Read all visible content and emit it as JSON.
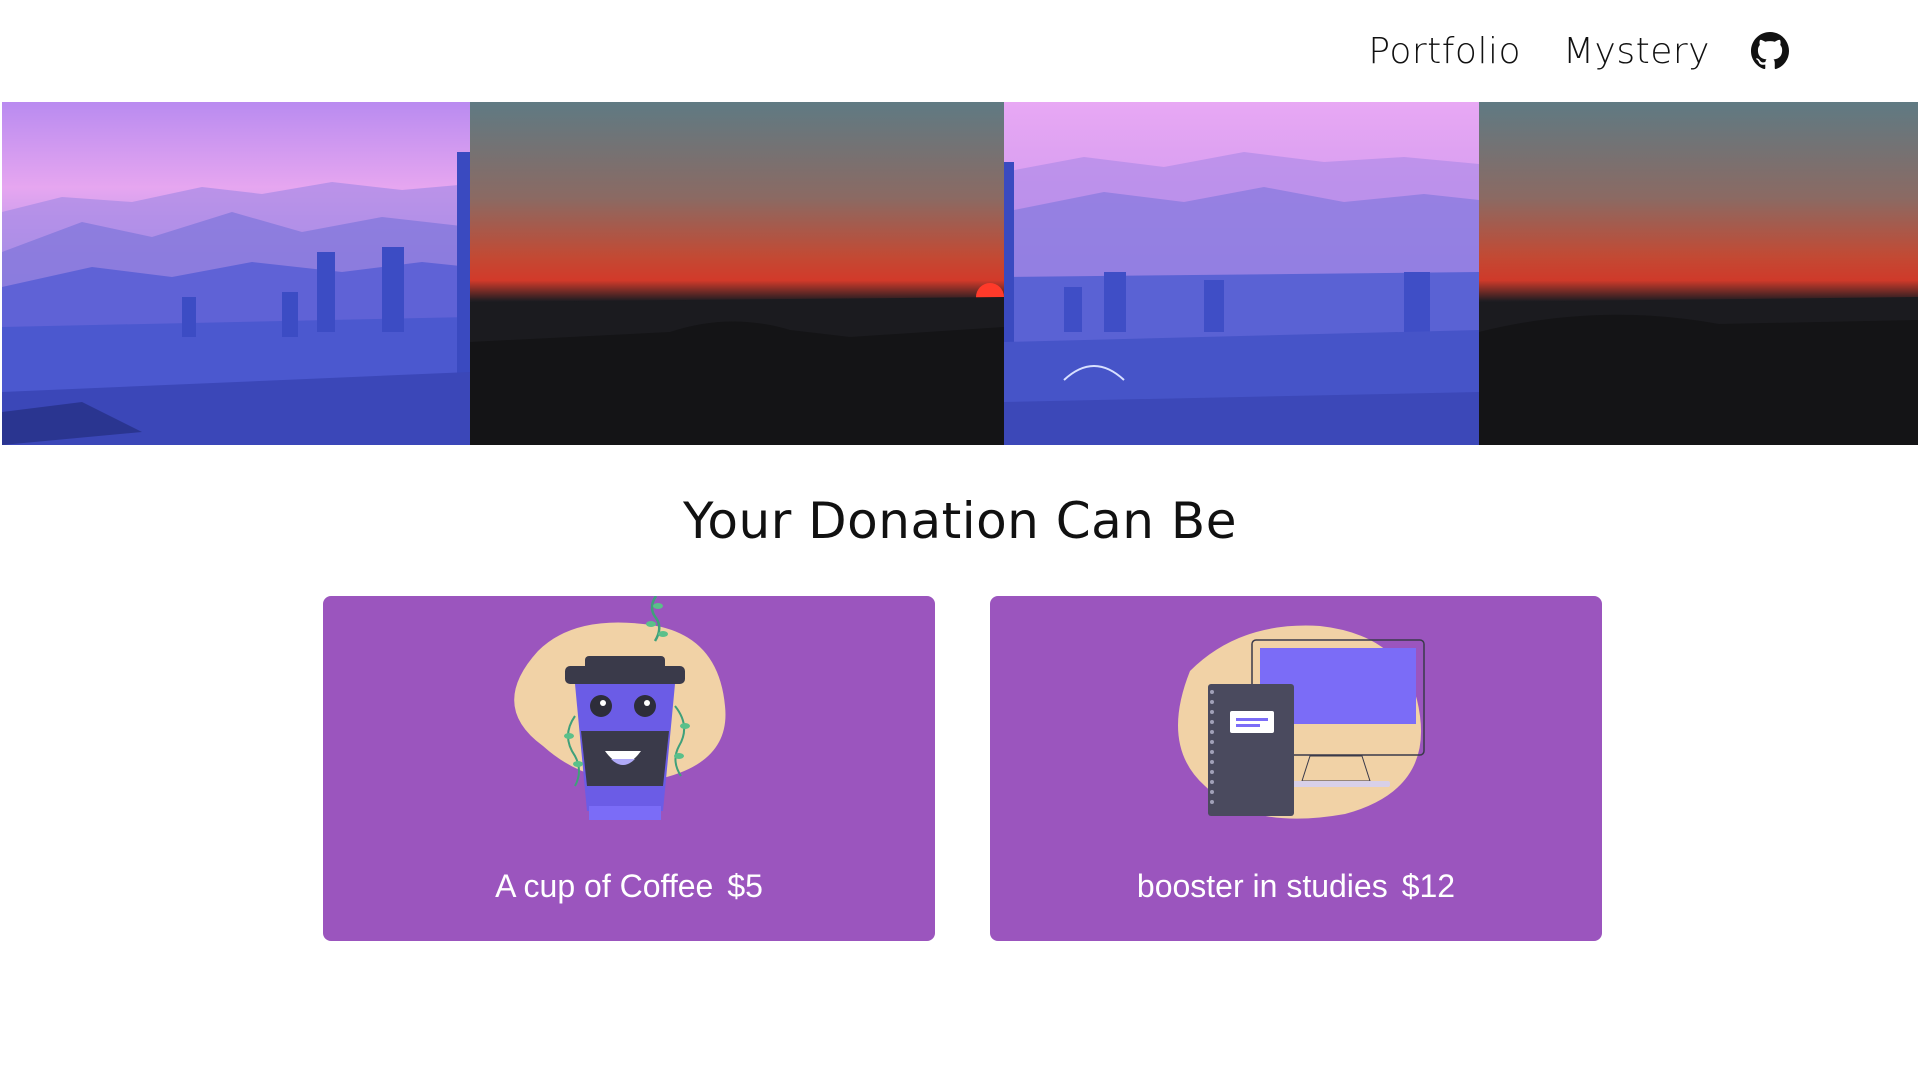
{
  "nav": {
    "items": [
      {
        "label": "Portfolio"
      },
      {
        "label": "Mystery"
      }
    ],
    "github_icon": "github-icon"
  },
  "banner": {
    "panels": [
      "city-mountain-view",
      "red-sunset",
      "city-mountain-view",
      "red-sunset"
    ]
  },
  "heading": "Your Donation Can Be",
  "cards": [
    {
      "title": "A cup of Coffee",
      "price": "$5",
      "icon": "coffee-cup-illustration"
    },
    {
      "title": "booster in studies",
      "price": "$12",
      "icon": "computer-notebook-illustration"
    }
  ],
  "colors": {
    "card_bg": "#9b55be",
    "blob": "#f1d2a6",
    "accent": "#7b6cf7"
  }
}
